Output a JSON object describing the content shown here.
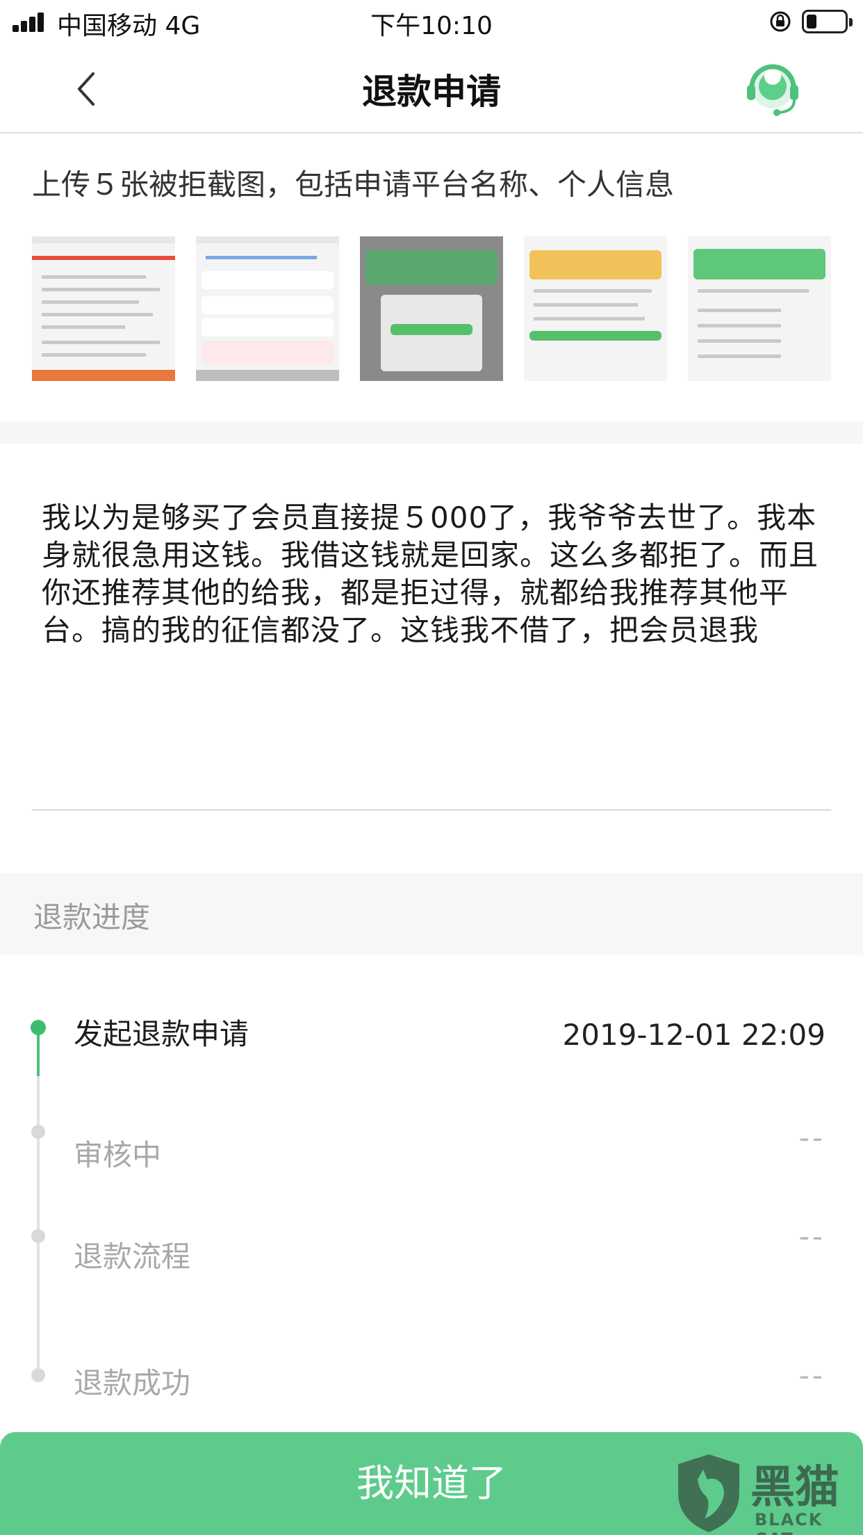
{
  "status_bar": {
    "carrier": "中国移动 4G",
    "time": "下午10:10"
  },
  "nav": {
    "title": "退款申请",
    "back_icon": "chevron-left-icon",
    "support_icon": "customer-service-headset-icon"
  },
  "upload": {
    "hint": "上传５张被拒截图，包括申请平台名称、个人信息",
    "thumbnails": [
      "screenshot-1",
      "screenshot-2",
      "screenshot-3",
      "screenshot-4",
      "screenshot-5"
    ]
  },
  "complaint": {
    "text": "我以为是够买了会员直接提５000了，我爷爷去世了。我本身就很急用这钱。我借这钱就是回家。这么多都拒了。而且你还推荐其他的给我，都是拒过得，就都给我推荐其他平台。搞的我的征信都没了。这钱我不借了，把会员退我"
  },
  "progress": {
    "title": "退款进度",
    "steps": [
      {
        "label": "发起退款申请",
        "time": "2019-12-01 22:09",
        "state": "done"
      },
      {
        "label": "审核中",
        "time": "--",
        "state": "pending"
      },
      {
        "label": "退款流程",
        "time": "--",
        "state": "pending"
      },
      {
        "label": "退款成功",
        "time": "--",
        "state": "pending"
      }
    ]
  },
  "footer": {
    "button_label": "我知道了"
  },
  "watermark": {
    "cn": "黑猫",
    "en": "BLACK CAT"
  },
  "colors": {
    "accent": "#3dbd6b",
    "button": "#5ecb8c",
    "muted": "#a8a8a8"
  }
}
